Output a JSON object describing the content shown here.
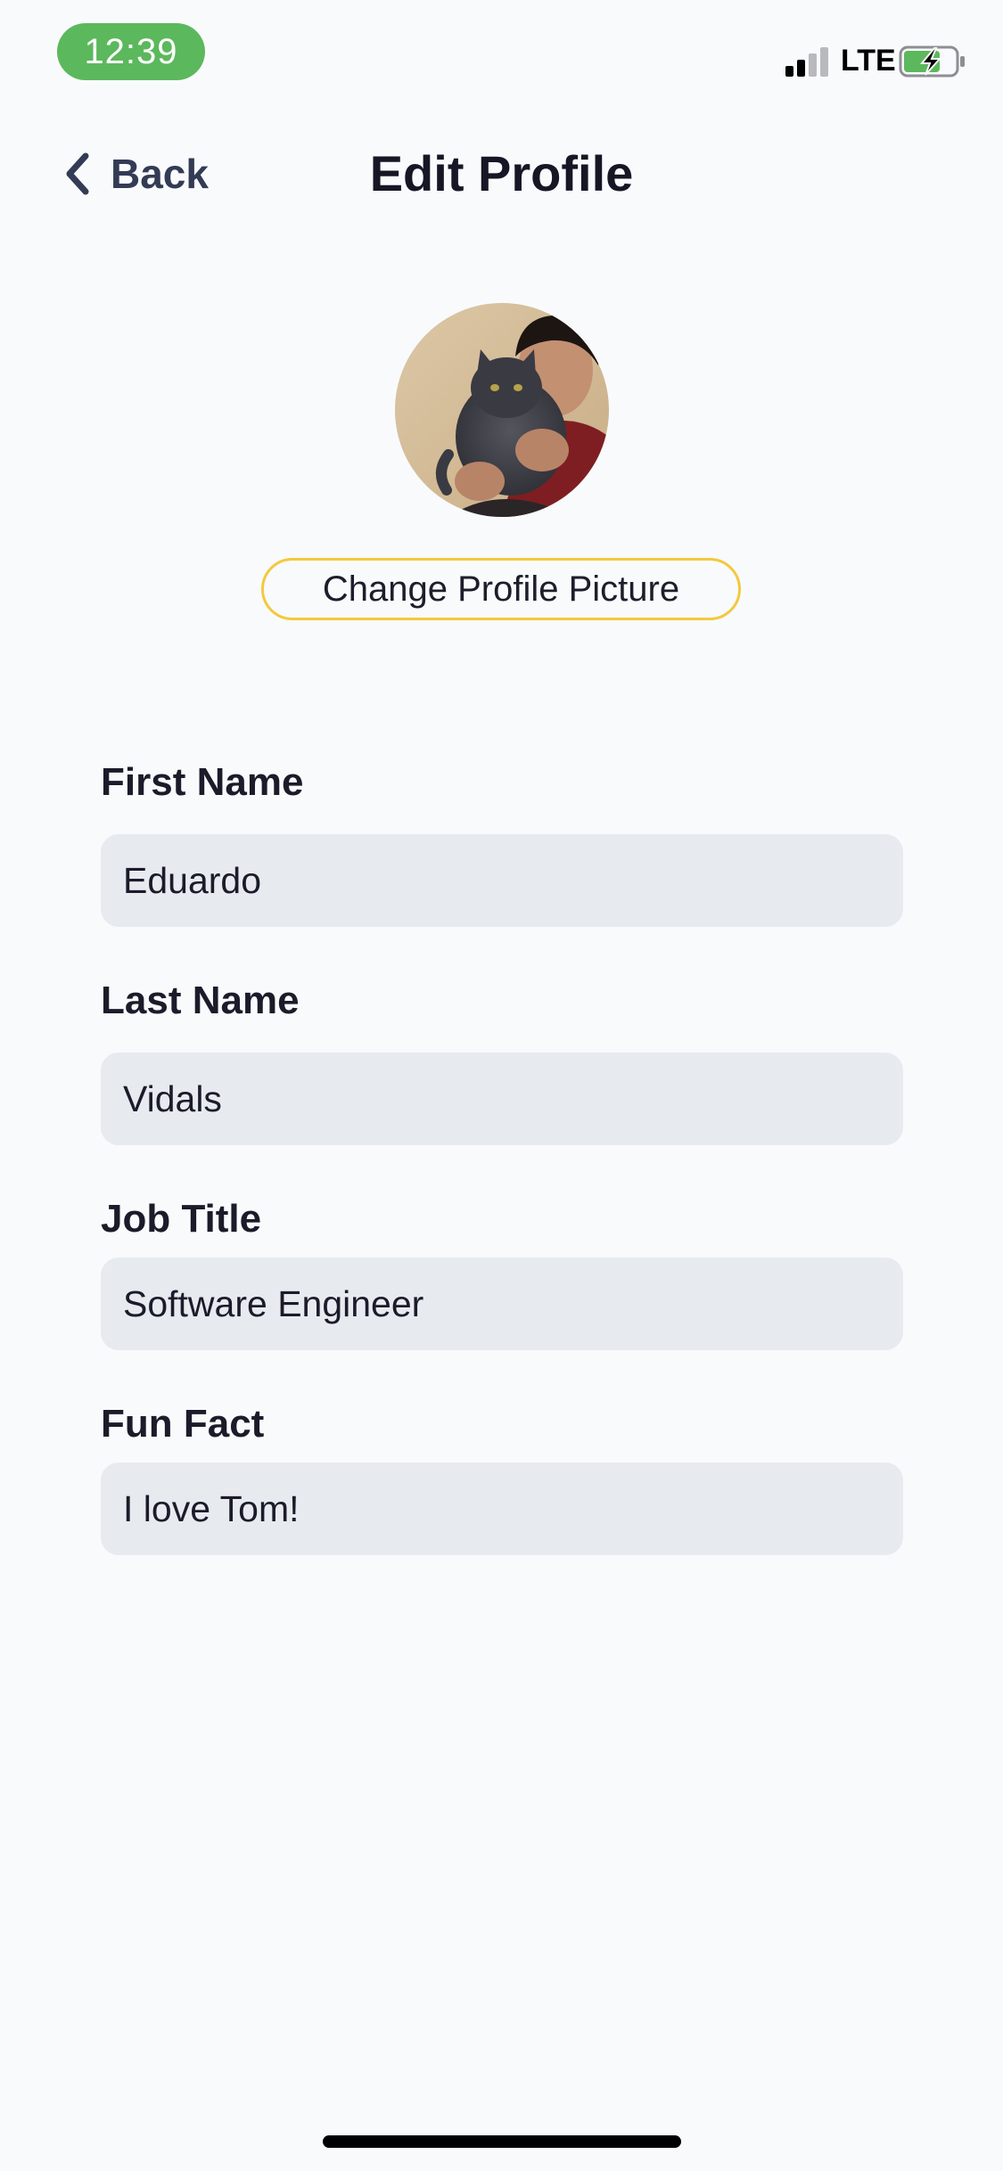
{
  "status_bar": {
    "time": "12:39",
    "network": "LTE",
    "signal_icon": "signal-bars-icon",
    "battery_icon": "battery-charging-icon"
  },
  "header": {
    "back_label": "Back",
    "title": "Edit Profile"
  },
  "profile": {
    "change_picture_label": "Change Profile Picture"
  },
  "form": {
    "first_name": {
      "label": "First Name",
      "value": "Eduardo"
    },
    "last_name": {
      "label": "Last Name",
      "value": "Vidals"
    },
    "job_title": {
      "label": "Job Title",
      "value": "Software Engineer"
    },
    "fun_fact": {
      "label": "Fun Fact",
      "value": "I love Tom!"
    }
  },
  "colors": {
    "background": "#f9fafc",
    "time_pill": "#5cb85c",
    "button_border": "#f3c93d",
    "input_background": "#e7ebf0",
    "battery_fill": "#5cb85c"
  }
}
